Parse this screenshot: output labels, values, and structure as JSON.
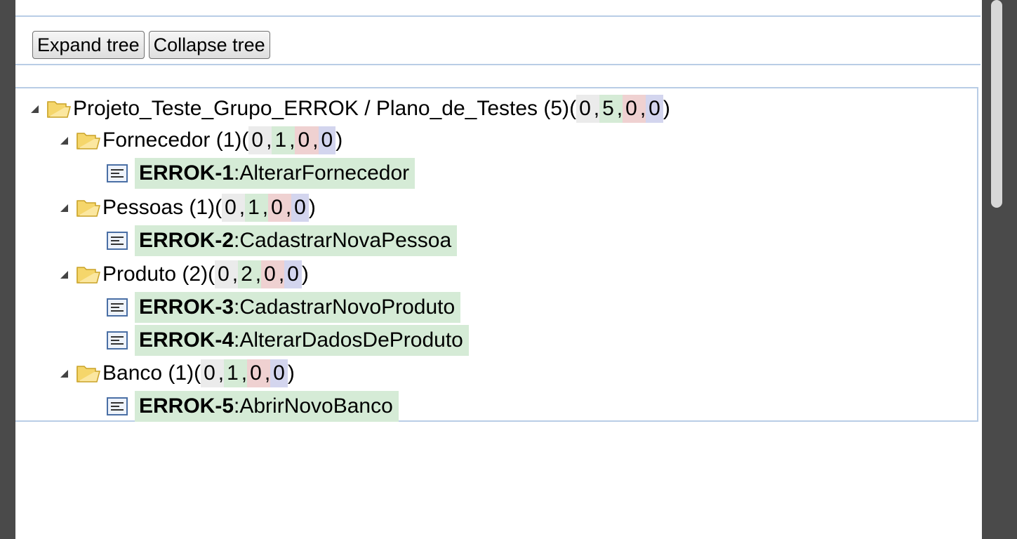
{
  "toolbar": {
    "expand_label": "Expand tree",
    "collapse_label": "Collapse tree"
  },
  "tree": {
    "root": {
      "label": "Projeto_Teste_Grupo_ERROK / Plano_de_Testes (5)",
      "counts": [
        "0",
        "5",
        "0",
        "0"
      ]
    },
    "suites": [
      {
        "label": "Fornecedor (1)",
        "counts": [
          "0",
          "1",
          "0",
          "0"
        ],
        "cases": [
          {
            "id": "ERROK-1",
            "name": ":AlterarFornecedor"
          }
        ]
      },
      {
        "label": "Pessoas (1)",
        "counts": [
          "0",
          "1",
          "0",
          "0"
        ],
        "cases": [
          {
            "id": "ERROK-2",
            "name": ":CadastrarNovaPessoa"
          }
        ]
      },
      {
        "label": "Produto (2)",
        "counts": [
          "0",
          "2",
          "0",
          "0"
        ],
        "cases": [
          {
            "id": "ERROK-3",
            "name": ":CadastrarNovoProduto"
          },
          {
            "id": "ERROK-4",
            "name": ":AlterarDadosDeProduto"
          }
        ]
      },
      {
        "label": "Banco (1)",
        "counts": [
          "0",
          "1",
          "0",
          "0"
        ],
        "cases": [
          {
            "id": "ERROK-5",
            "name": ":AbrirNovoBanco"
          }
        ]
      }
    ]
  },
  "colors": {
    "not_run": "#ebebeb",
    "passed": "#d5ebd6",
    "failed": "#efd1d1",
    "blocked": "#d3d5ee",
    "frame_border": "#b9cde6"
  },
  "icons": {
    "expander": "triangle-expanded-icon",
    "suite": "folder-open-icon",
    "case": "test-case-icon"
  }
}
